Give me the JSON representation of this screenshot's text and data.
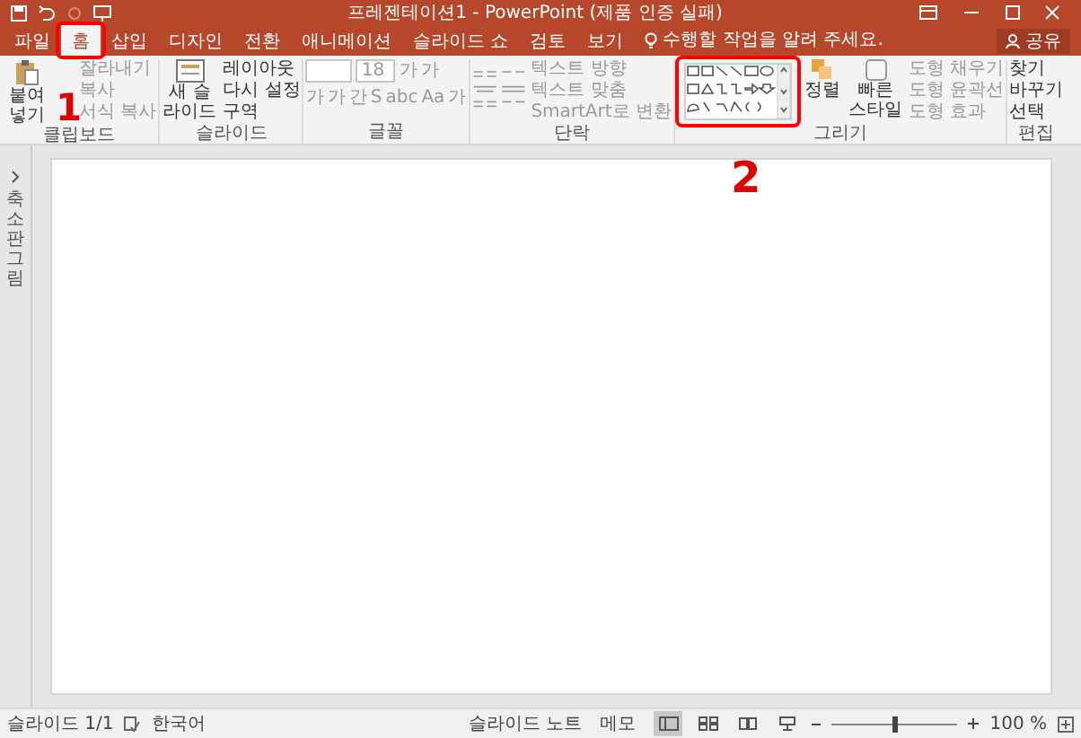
{
  "title_bar": {
    "title": "프레젠테이션1 - PowerPoint (제품 인증 실패)",
    "share": "공유"
  },
  "tabs": [
    {
      "label": "파일",
      "selected": false
    },
    {
      "label": "홈",
      "selected": true
    },
    {
      "label": "삽입",
      "selected": false
    },
    {
      "label": "디자인",
      "selected": false
    },
    {
      "label": "전환",
      "selected": false
    },
    {
      "label": "애니메이션",
      "selected": false
    },
    {
      "label": "슬라이드 쇼",
      "selected": false
    },
    {
      "label": "검토",
      "selected": false
    },
    {
      "label": "보기",
      "selected": false
    }
  ],
  "tell_me": {
    "placeholder": "수행할 작업을 알려 주세요."
  },
  "ribbon": {
    "clipboard": {
      "label": "클립보드",
      "paste": "붙여넣기",
      "items": [
        {
          "label": "잘라내기",
          "disabled": true
        },
        {
          "label": "복사",
          "disabled": true
        },
        {
          "label": "서식 복사",
          "disabled": true
        }
      ]
    },
    "slides": {
      "label": "슬라이드",
      "new_slide": "새 슬라이드",
      "items": [
        "레이아웃",
        "다시 설정",
        "구역"
      ]
    },
    "font": {
      "label": "글꼴",
      "size": "18",
      "size_buttons": [
        "가",
        "가"
      ],
      "format_buttons": [
        "가",
        "가",
        "간",
        "S",
        "abc",
        "Aa",
        "가"
      ]
    },
    "paragraph": {
      "label": "단락",
      "items": [
        "텍스트 방향",
        "텍스트 맞춤",
        "SmartArt로 변환"
      ]
    },
    "drawing": {
      "label": "그리기",
      "arrange": "정렬",
      "quick_styles": "빠른 스타일",
      "items": [
        "도형 채우기",
        "도형 윤곽선",
        "도형 효과"
      ]
    },
    "editing": {
      "label": "편집",
      "items": [
        "찾기",
        "바꾸기",
        "선택"
      ]
    }
  },
  "thumbnail_pane": {
    "label": "축소판 그림"
  },
  "status_bar": {
    "slide": "슬라이드 1/1",
    "language": "한국어",
    "notes": "슬라이드 노트",
    "comments": "메모",
    "views": [
      {
        "kind": "normal",
        "selected": true
      },
      {
        "kind": "sorter",
        "selected": false
      },
      {
        "kind": "reading",
        "selected": false
      },
      {
        "kind": "show",
        "selected": false
      }
    ],
    "zoom": {
      "level": 0.5,
      "reading": "100 %"
    }
  },
  "annotations": [
    {
      "label": "1"
    },
    {
      "label": "2"
    }
  ]
}
